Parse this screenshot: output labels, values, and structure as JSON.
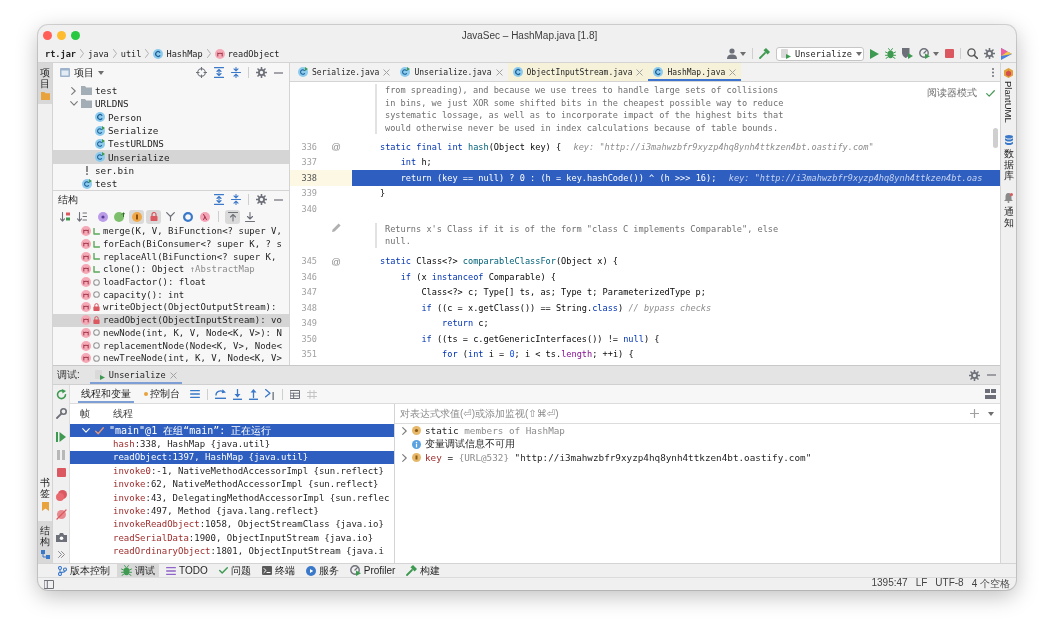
{
  "window": {
    "title": "JavaSec – HashMap.java [1.8]"
  },
  "breadcrumbs": [
    {
      "label": "rt.jar",
      "kind": "jar"
    },
    {
      "label": "java",
      "kind": "package"
    },
    {
      "label": "util",
      "kind": "package"
    },
    {
      "label": "HashMap",
      "kind": "class"
    },
    {
      "label": "readObject",
      "kind": "method"
    }
  ],
  "toolbar": {
    "run_config": "Unserialize"
  },
  "left_stripe": {
    "top": [
      {
        "label": "项目",
        "kind": "project",
        "selected": true
      }
    ],
    "bottom": [
      {
        "label": "书签",
        "kind": "bookmarks",
        "selected": false
      },
      {
        "label": "结构",
        "kind": "structure",
        "selected": true
      }
    ]
  },
  "right_stripe": [
    {
      "label": "PlantUML",
      "kind": "plantuml"
    },
    {
      "label": "数据库",
      "kind": "database"
    },
    {
      "label": "通知",
      "kind": "notifications"
    }
  ],
  "project_panel": {
    "title": "项目",
    "tree": [
      {
        "label": "test",
        "kind": "folder",
        "expanded": false,
        "selected": false
      },
      {
        "label": "URLDNS",
        "kind": "folder",
        "expanded": true,
        "selected": false,
        "children": [
          {
            "label": "Person",
            "kind": "class",
            "selected": false
          },
          {
            "label": "Serialize",
            "kind": "main-class",
            "selected": false
          },
          {
            "label": "TestURLDNS",
            "kind": "main-class",
            "selected": false
          },
          {
            "label": "Unserialize",
            "kind": "main-class",
            "selected": true
          }
        ]
      },
      {
        "label": "ser.bin",
        "kind": "file",
        "selected": false
      },
      {
        "label": "test",
        "kind": "main-class",
        "selected": false
      }
    ]
  },
  "structure_panel": {
    "title": "结构",
    "toggle_groups": [
      [
        {
          "kind": "sort-visibility",
          "on": false
        },
        {
          "kind": "sort-alpha",
          "on": false
        }
      ],
      [
        {
          "kind": "property",
          "on": false
        },
        {
          "kind": "inherited",
          "on": false
        },
        {
          "kind": "field",
          "on": true
        },
        {
          "kind": "non-public",
          "on": true
        },
        {
          "kind": "fork",
          "on": false
        },
        {
          "kind": "anonymous",
          "on": false
        },
        {
          "kind": "lambda",
          "on": false
        }
      ],
      [
        {
          "kind": "autoscroll-to",
          "on": true
        },
        {
          "kind": "autoscroll-from",
          "on": false
        }
      ]
    ],
    "items": [
      {
        "label": "merge(K, V, BiFunction<? super V,",
        "kind": "public",
        "selected": false
      },
      {
        "label": "forEach(BiConsumer<? super K, ? s",
        "kind": "public",
        "selected": false
      },
      {
        "label": "replaceAll(BiFunction<? super K,",
        "kind": "public",
        "selected": false
      },
      {
        "label": "clone(): Object",
        "origin": "↑AbstractMap",
        "kind": "public",
        "selected": false
      },
      {
        "label": "loadFactor(): float",
        "kind": "package",
        "selected": false
      },
      {
        "label": "capacity(): int",
        "kind": "package",
        "selected": false
      },
      {
        "label": "writeObject(ObjectOutputStream):",
        "kind": "private",
        "selected": false
      },
      {
        "label": "readObject(ObjectInputStream): vo",
        "kind": "private",
        "selected": true
      },
      {
        "label": "newNode(int, K, V, Node<K, V>): N",
        "kind": "package",
        "selected": false
      },
      {
        "label": "replacementNode(Node<K, V>, Node<",
        "kind": "package",
        "selected": false
      },
      {
        "label": "newTreeNode(int, K, V, Node<K, V>",
        "kind": "package",
        "selected": false
      }
    ]
  },
  "editor": {
    "tabs": [
      {
        "label": "Serialize.java",
        "kind": "main-class",
        "library": false,
        "selected": false
      },
      {
        "label": "Unserialize.java",
        "kind": "main-class",
        "library": false,
        "selected": false
      },
      {
        "label": "ObjectInputStream.java",
        "kind": "class",
        "library": true,
        "selected": false
      },
      {
        "label": "HashMap.java",
        "kind": "class",
        "library": true,
        "selected": true
      }
    ],
    "reader_mode": {
      "label": "阅读器模式"
    },
    "blocks": [
      {
        "kind": "doc",
        "editable": false,
        "lines": [
          "from spreading), and because we use trees to handle large sets of collisions",
          "in bins, we just XOR some shifted bits in the cheapest possible way to reduce",
          "systematic lossage, as well as to incorporate impact of the highest bits that",
          "would otherwise never be used in index calculations because of table bounds."
        ]
      },
      {
        "kind": "code",
        "number": "336",
        "marker": "@",
        "current": false,
        "tokens": [
          {
            "text": "static final int ",
            "kind": "keyword"
          },
          {
            "text": "hash",
            "kind": "method"
          },
          {
            "text": "(Object key) {",
            "kind": "plain"
          }
        ],
        "hint": "key: \"http://i3mahwzbfr9xyzp4hq8ynh4ttkzen4bt.oastify.com\""
      },
      {
        "kind": "code",
        "number": "337",
        "current": false,
        "tokens": [
          {
            "text": "    int",
            "kind": "keyword"
          },
          {
            "text": " h;",
            "kind": "plain"
          }
        ]
      },
      {
        "kind": "code",
        "number": "338",
        "current": true,
        "tokens": [
          {
            "text": "    return",
            "kind": "keyword"
          },
          {
            "text": " (key == ",
            "kind": "plain"
          },
          {
            "text": "null",
            "kind": "keyword"
          },
          {
            "text": ") ? ",
            "kind": "plain"
          },
          {
            "text": "0",
            "kind": "number"
          },
          {
            "text": " : (h = key.hashCode()) ^ (h >>> ",
            "kind": "plain"
          },
          {
            "text": "16",
            "kind": "number"
          },
          {
            "text": ");",
            "kind": "plain"
          }
        ],
        "hint": "key: \"http://i3mahwzbfr9xyzp4hq8ynh4ttkzen4bt.oas"
      },
      {
        "kind": "code",
        "number": "339",
        "current": false,
        "tokens": [
          {
            "text": "}",
            "kind": "plain"
          }
        ]
      },
      {
        "kind": "code",
        "number": "340",
        "current": false
      },
      {
        "kind": "doc",
        "editable": true,
        "lines": [
          "Returns x's Class if it is of the form \"class C implements Comparable\", else",
          "null."
        ]
      },
      {
        "kind": "code",
        "number": "345",
        "marker": "@",
        "current": false,
        "tokens": [
          {
            "text": "static",
            "kind": "keyword"
          },
          {
            "text": " Class<?> ",
            "kind": "plain"
          },
          {
            "text": "comparableClassFor",
            "kind": "method"
          },
          {
            "text": "(Object x) {",
            "kind": "plain"
          }
        ]
      },
      {
        "kind": "code",
        "number": "346",
        "current": false,
        "tokens": [
          {
            "text": "    if",
            "kind": "keyword"
          },
          {
            "text": " (x ",
            "kind": "plain"
          },
          {
            "text": "instanceof",
            "kind": "keyword"
          },
          {
            "text": " Comparable) {",
            "kind": "plain"
          }
        ]
      },
      {
        "kind": "code",
        "number": "347",
        "current": false,
        "tokens": [
          {
            "text": "        Class<?> c; Type[] ts, as; Type t; ParameterizedType p;",
            "kind": "plain"
          }
        ]
      },
      {
        "kind": "code",
        "number": "348",
        "current": false,
        "tokens": [
          {
            "text": "        if",
            "kind": "keyword"
          },
          {
            "text": " ((c = x.getClass()) == String.",
            "kind": "plain"
          },
          {
            "text": "class",
            "kind": "keyword"
          },
          {
            "text": ") ",
            "kind": "plain"
          },
          {
            "text": "// bypass checks",
            "kind": "comment"
          }
        ]
      },
      {
        "kind": "code",
        "number": "349",
        "current": false,
        "tokens": [
          {
            "text": "            return",
            "kind": "keyword"
          },
          {
            "text": " c;",
            "kind": "plain"
          }
        ]
      },
      {
        "kind": "code",
        "number": "350",
        "current": false,
        "tokens": [
          {
            "text": "        if",
            "kind": "keyword"
          },
          {
            "text": " ((ts = c.getGenericInterfaces()) != ",
            "kind": "plain"
          },
          {
            "text": "null",
            "kind": "keyword"
          },
          {
            "text": ") {",
            "kind": "plain"
          }
        ]
      },
      {
        "kind": "code",
        "number": "351",
        "current": false,
        "tokens": [
          {
            "text": "            for",
            "kind": "keyword"
          },
          {
            "text": " (",
            "kind": "plain"
          },
          {
            "text": "int",
            "kind": "keyword"
          },
          {
            "text": " i = ",
            "kind": "plain"
          },
          {
            "text": "0",
            "kind": "number"
          },
          {
            "text": "; i < ts.",
            "kind": "plain"
          },
          {
            "text": "length",
            "kind": "field"
          },
          {
            "text": "; ++i) {",
            "kind": "plain"
          }
        ]
      }
    ]
  },
  "debug": {
    "title": "调试:",
    "sessions": [
      {
        "label": "Unserialize",
        "selected": true
      }
    ],
    "views": [
      {
        "label": "线程和变量",
        "kind": "threads",
        "selected": true
      },
      {
        "label": "控制台",
        "kind": "console",
        "selected": false
      }
    ],
    "frames_header": [
      "帧",
      "线程"
    ],
    "frames": [
      {
        "kind": "thread",
        "label": "\"main\"@1 在组“main”: 正在运行",
        "expanded": true,
        "selected": true
      },
      {
        "kind": "frame",
        "method": "hash",
        "location": ":338, HashMap {java.util}",
        "selected": false
      },
      {
        "kind": "frame",
        "method": "readObject",
        "location": ":1397, HashMap {java.util}",
        "selected": true
      },
      {
        "kind": "frame",
        "method": "invoke0",
        "location": ":-1, NativeMethodAccessorImpl {sun.reflect}",
        "selected": false
      },
      {
        "kind": "frame",
        "method": "invoke",
        "location": ":62, NativeMethodAccessorImpl {sun.reflect}",
        "selected": false
      },
      {
        "kind": "frame",
        "method": "invoke",
        "location": ":43, DelegatingMethodAccessorImpl {sun.reflec",
        "selected": false
      },
      {
        "kind": "frame",
        "method": "invoke",
        "location": ":497, Method {java.lang.reflect}",
        "selected": false
      },
      {
        "kind": "frame",
        "method": "invokeReadObject",
        "location": ":1058, ObjectStreamClass {java.io}",
        "selected": false
      },
      {
        "kind": "frame",
        "method": "readSerialData",
        "location": ":1900, ObjectInputStream {java.io}",
        "selected": false
      },
      {
        "kind": "frame",
        "method": "readOrdinaryObject",
        "location": ":1801, ObjectInputStream {java.i",
        "selected": false
      }
    ],
    "evaluate": {
      "placeholder": "对表达式求值(⏎)或添加监视(⇧⌘⏎)"
    },
    "variables": [
      {
        "kind": "static",
        "name": "static",
        "value": "members of HashMap",
        "expanded": false
      },
      {
        "kind": "info",
        "name": "变量调试信息不可用"
      },
      {
        "kind": "param",
        "name": "key",
        "separator": "=",
        "type": "{URL@532}",
        "value": "\"http://i3mahwzbfr9xyzp4hq8ynh4ttkzen4bt.oastify.com\"",
        "expanded": false
      }
    ]
  },
  "tool_stripe": [
    {
      "label": "版本控制",
      "kind": "vcs",
      "selected": false
    },
    {
      "label": "调试",
      "kind": "debug",
      "selected": true
    },
    {
      "label": "TODO",
      "kind": "todo",
      "selected": false
    },
    {
      "label": "问题",
      "kind": "problems",
      "selected": false
    },
    {
      "label": "终端",
      "kind": "terminal",
      "selected": false
    },
    {
      "label": "服务",
      "kind": "services",
      "selected": false
    },
    {
      "label": "Profiler",
      "kind": "profiler",
      "selected": false
    },
    {
      "label": "构建",
      "kind": "build",
      "selected": false
    }
  ],
  "status_bar": {
    "items": [
      "1395:47",
      "LF",
      "UTF-8",
      "4 个空格"
    ]
  }
}
